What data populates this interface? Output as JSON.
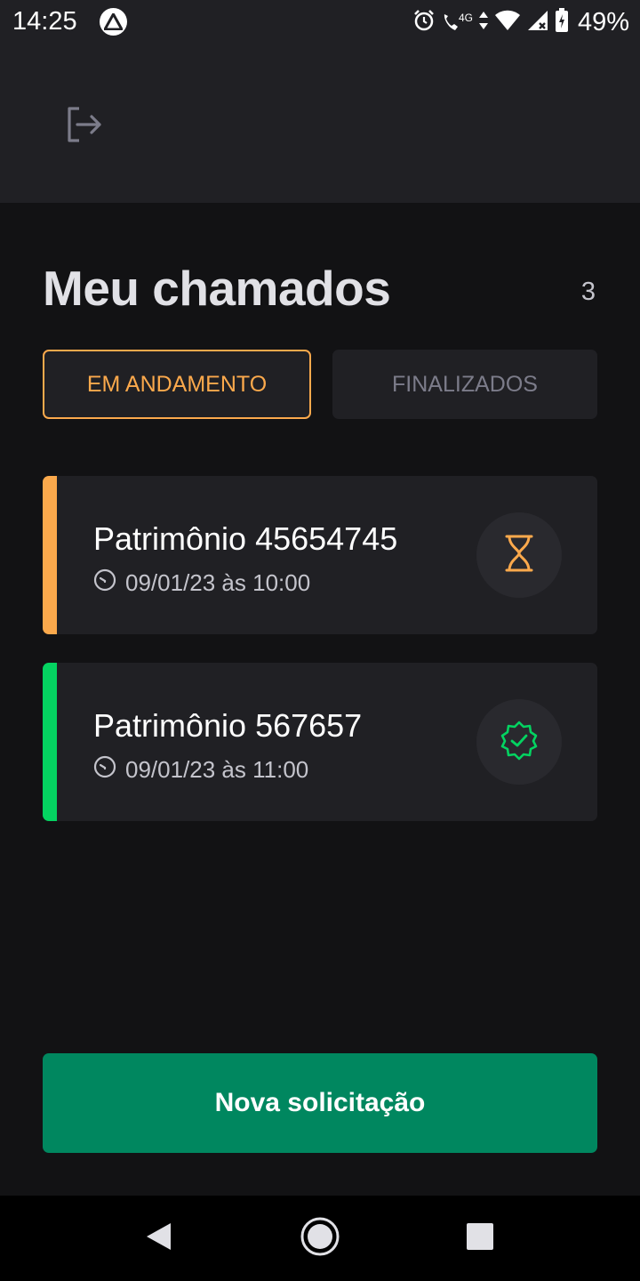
{
  "status_bar": {
    "time": "14:25",
    "network": "4G",
    "battery": "49%",
    "icons": [
      "app-icon",
      "alarm-icon",
      "call-icon",
      "data-icon",
      "wifi-icon",
      "signal-icon",
      "battery-icon"
    ]
  },
  "header": {
    "logout_icon": "logout-icon"
  },
  "page": {
    "title": "Meu chamados",
    "count": "3"
  },
  "filters": [
    {
      "label": "EM ANDAMENTO",
      "active": true
    },
    {
      "label": "FINALIZADOS",
      "active": false
    }
  ],
  "orders": [
    {
      "title": "Patrimônio 45654745",
      "date": "09/01/23 às 10:00",
      "status": "open",
      "status_icon": "hourglass-icon",
      "color": "#fba94c"
    },
    {
      "title": "Patrimônio 567657",
      "date": "09/01/23 às 11:00",
      "status": "closed",
      "status_icon": "check-badge-icon",
      "color": "#04d361"
    }
  ],
  "actions": {
    "new_request": "Nova solicitação"
  },
  "colors": {
    "background": "#121214",
    "surface": "#202024",
    "accent_orange": "#fba94c",
    "accent_green": "#04d361",
    "primary": "#00875f"
  }
}
